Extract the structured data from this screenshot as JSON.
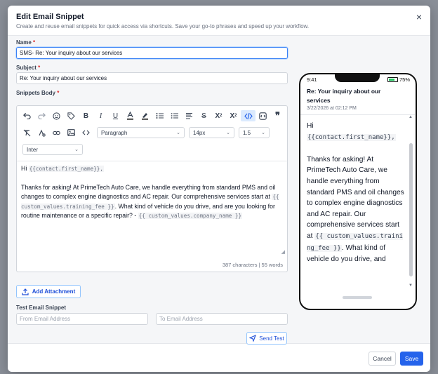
{
  "modal": {
    "title": "Edit Email Snippet",
    "subtitle": "Create and reuse email snippets for quick access via shortcuts. Save your go-to phrases and speed up your workflow.",
    "close": "×"
  },
  "form": {
    "name_label": "Name",
    "name_value": "SMS- Re: Your inquiry about our services",
    "subject_label": "Subject",
    "subject_value": "Re: Your inquiry about our services",
    "body_label": "Snippets Body",
    "required_mark": "*"
  },
  "toolbar": {
    "icons": [
      "undo-icon",
      "redo-icon",
      "emoji-icon",
      "tag-icon",
      "bold-icon",
      "italic-icon",
      "underline-icon",
      "text-color-icon",
      "highlight-icon",
      "bulleted-list-icon",
      "numbered-list-icon",
      "align-icon",
      "strikethrough-icon",
      "superscript-icon",
      "subscript-icon",
      "code-view-icon",
      "embed-icon",
      "quote-icon",
      "clear-format-icon",
      "merge-field-icon",
      "link-icon",
      "image-icon",
      "code-icon"
    ],
    "block_format": "Paragraph",
    "font_size": "14px",
    "line_height": "1.5",
    "font_family": "Inter"
  },
  "editor": {
    "line1_prefix": "Hi",
    "var_first_name": "{{contact.first_name}},",
    "para2_a": "Thanks for asking! At PrimeTech Auto Care, we handle everything from standard PMS and oil changes to complex engine diagnostics and AC repair. Our comprehensive services start at",
    "var_fee": "{{ custom_values.training_fee }}",
    "para2_b": ". What kind of vehicle do you drive, and are you looking for routine maintenance or a specific repair? -",
    "var_company": "{{ custom_values.company_name }}",
    "count": "387 characters | 55 words"
  },
  "attach": {
    "label": "Add Attachment"
  },
  "test": {
    "label": "Test Email Snippet",
    "from_placeholder": "From Email Address",
    "to_placeholder": "To Email Address",
    "send_label": "Send Test"
  },
  "preview": {
    "time": "9:41",
    "battery": "75%",
    "battery_level": 0.75,
    "subject": "Re: Your inquiry about our services",
    "date": "3/22/2026 at 02:12 PM",
    "greeting": "Hi",
    "var_first_name": "{{contact.first_name}},",
    "para": "Thanks for asking! At PrimeTech Auto Care, we handle everything from standard PMS and oil changes to complex engine diagnostics and AC repair. Our comprehensive services start at",
    "var_fee": "{{ custom_values.training_fee }}",
    "para_end": ". What kind of vehicle do you drive, and"
  },
  "footer": {
    "cancel": "Cancel",
    "save": "Save"
  },
  "colors": {
    "accent": "#2563eb",
    "required": "#dc2626"
  }
}
